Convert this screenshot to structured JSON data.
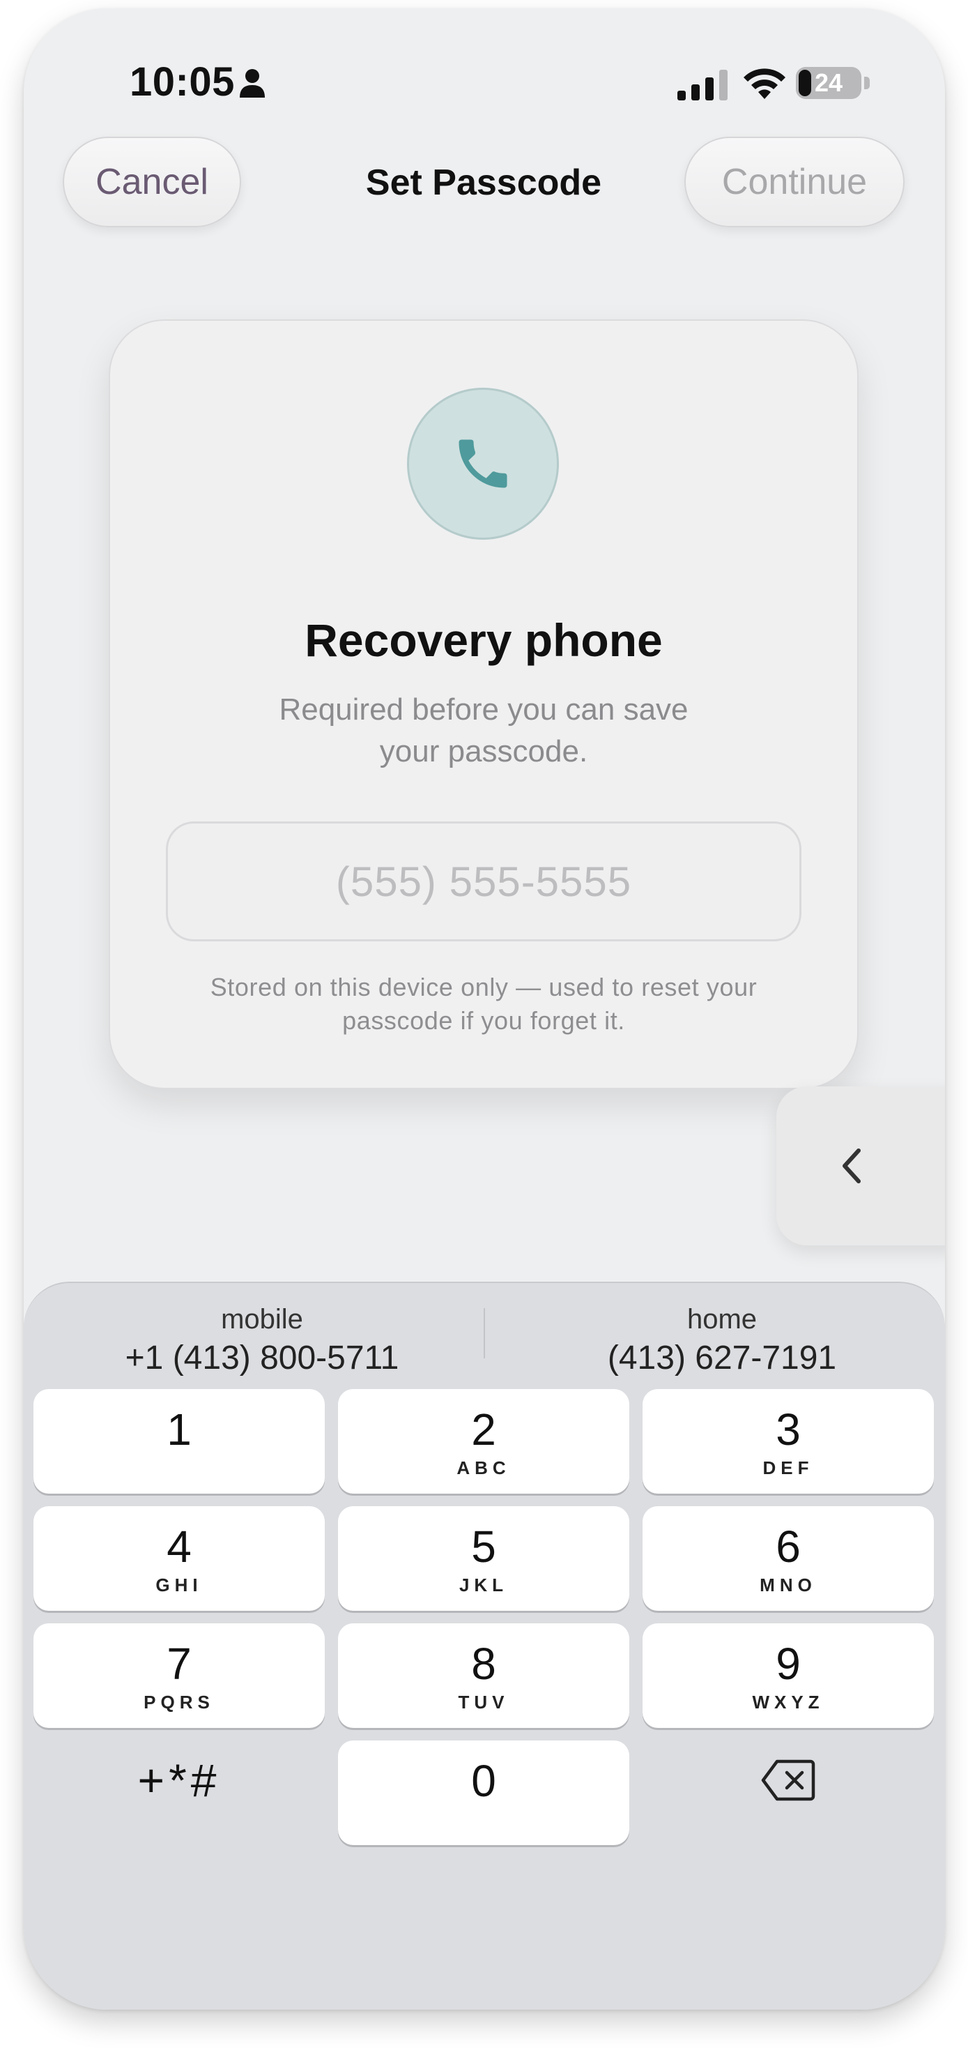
{
  "status_bar": {
    "time": "10:05",
    "battery": "24",
    "icons": [
      "person-icon",
      "signal-icon",
      "wifi-icon",
      "battery-icon"
    ]
  },
  "nav": {
    "cancel_label": "Cancel",
    "title": "Set Passcode",
    "continue_label": "Continue"
  },
  "card": {
    "icon": "phone-icon",
    "title": "Recovery phone",
    "subtitle_line1": "Required before you can save",
    "subtitle_line2": "your passcode.",
    "phone_placeholder": "(555) 555-5555",
    "note_line1": "Stored on this device only — used to reset your",
    "note_line2": "passcode if you forget it."
  },
  "side_tab": {
    "icon": "chevron-left-icon"
  },
  "keyboard": {
    "suggestions": [
      {
        "label": "mobile",
        "number": "+1 (413) 800-5711"
      },
      {
        "label": "home",
        "number": "(413) 627-7191"
      }
    ],
    "keys": [
      {
        "digit": "1",
        "letters": ""
      },
      {
        "digit": "2",
        "letters": "ABC"
      },
      {
        "digit": "3",
        "letters": "DEF"
      },
      {
        "digit": "4",
        "letters": "GHI"
      },
      {
        "digit": "5",
        "letters": "JKL"
      },
      {
        "digit": "6",
        "letters": "MNO"
      },
      {
        "digit": "7",
        "letters": "PQRS"
      },
      {
        "digit": "8",
        "letters": "TUV"
      },
      {
        "digit": "9",
        "letters": "WXYZ"
      },
      {
        "digit": "0",
        "letters": ""
      }
    ],
    "symbols_label": "+*#",
    "delete_icon": "backspace-icon"
  },
  "colors": {
    "accent_teal": "#4f9a9c",
    "cancel_text": "#6a5a72",
    "disabled_text": "#a8a8aa"
  }
}
